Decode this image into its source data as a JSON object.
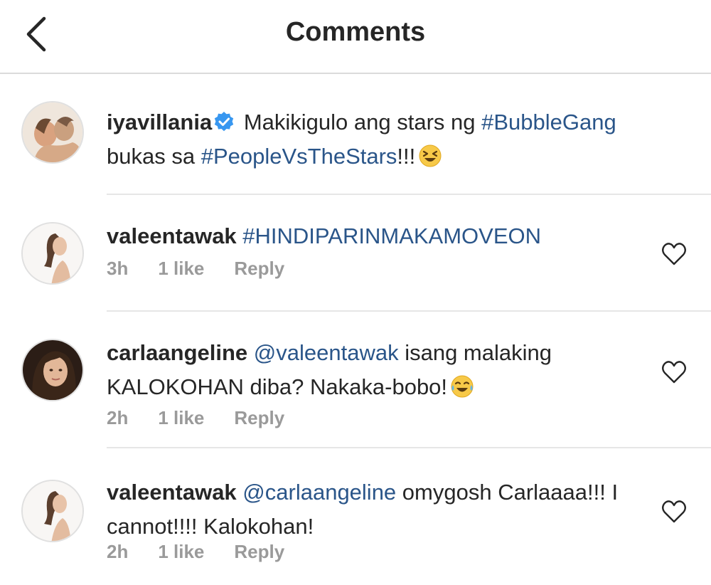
{
  "header": {
    "title": "Comments",
    "back_icon": "chevron-left-icon"
  },
  "caption": {
    "username": "iyavillania",
    "text_1": " Makikigulo ang stars ng ",
    "tag_1": "#BubbleGang",
    "text_2": " bukas sa ",
    "tag_2": "#PeopleVsTheStars",
    "text_3": "!!!",
    "emoji": "laughing-face-icon"
  },
  "comments": [
    {
      "username": "valeentawak",
      "mention": "",
      "text_pre": " ",
      "tag": "#HINDIPARINMAKAMOVEON",
      "text": "",
      "time": "3h",
      "likes": "1 like",
      "reply": "Reply"
    },
    {
      "username": "carlaangeline",
      "text_pre": " ",
      "mention": "@valeentawak",
      "text": " isang malaking KALOKOHAN diba? Nakaka-bobo!",
      "emoji": "tears-of-joy-icon",
      "time": "2h",
      "likes": "1 like",
      "reply": "Reply"
    },
    {
      "username": "valeentawak",
      "text_pre": " ",
      "mention": "@carlaangeline",
      "text": " omygosh Carlaaaa!!! I cannot!!!! Kalokohan!",
      "time": "2h",
      "likes": "1 like",
      "reply": "Reply"
    }
  ],
  "colors": {
    "link": "#2a5589",
    "meta": "#9a9a9a",
    "verified": "#3897f0",
    "divider": "#e6e6e6"
  }
}
